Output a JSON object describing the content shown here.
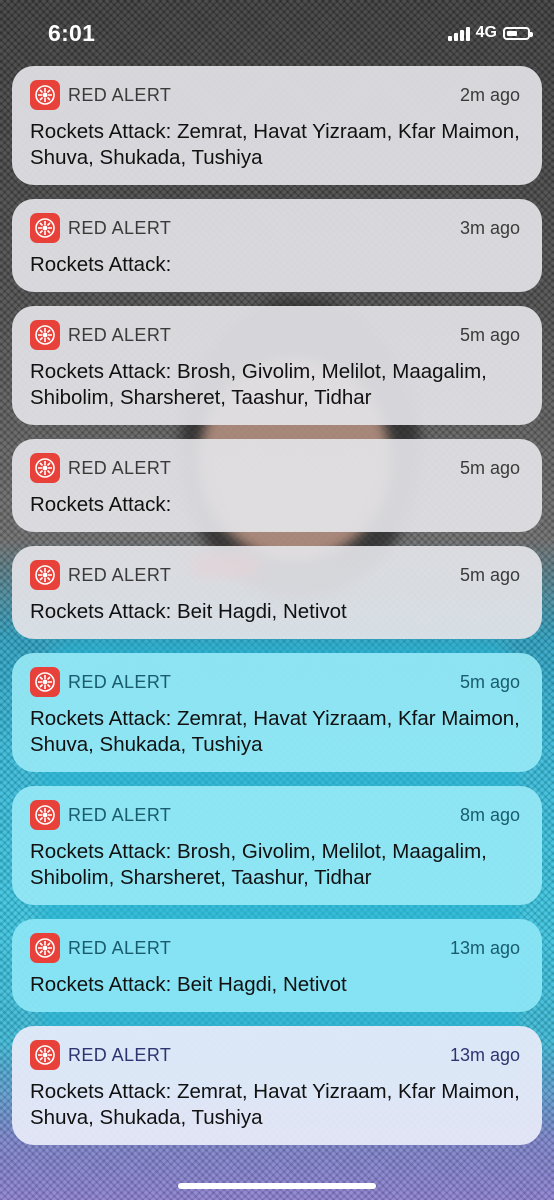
{
  "status_bar": {
    "time": "6:01",
    "network": "4G",
    "icons": [
      "signal-icon",
      "battery-icon"
    ]
  },
  "colors": {
    "app_icon": "#e8413a"
  },
  "notifications": [
    {
      "app": "RED ALERT",
      "time": "2m ago",
      "body": "Rockets Attack: Zemrat, Havat Yizraam, Kfar Maimon, Shuva, Shukada, Tushiya"
    },
    {
      "app": "RED ALERT",
      "time": "3m ago",
      "body": "Rockets Attack:"
    },
    {
      "app": "RED ALERT",
      "time": "5m ago",
      "body": "Rockets Attack: Brosh, Givolim, Melilot, Maagalim, Shibolim, Sharsheret, Taashur, Tidhar"
    },
    {
      "app": "RED ALERT",
      "time": "5m ago",
      "body": "Rockets Attack:"
    },
    {
      "app": "RED ALERT",
      "time": "5m ago",
      "body": "Rockets Attack: Beit Hagdi, Netivot"
    },
    {
      "app": "RED ALERT",
      "time": "5m ago",
      "body": "Rockets Attack: Zemrat, Havat Yizraam, Kfar Maimon, Shuva, Shukada, Tushiya"
    },
    {
      "app": "RED ALERT",
      "time": "8m ago",
      "body": "Rockets Attack: Brosh, Givolim, Melilot, Maagalim, Shibolim, Sharsheret, Taashur, Tidhar"
    },
    {
      "app": "RED ALERT",
      "time": "13m ago",
      "body": "Rockets Attack: Beit Hagdi, Netivot"
    },
    {
      "app": "RED ALERT",
      "time": "13m ago",
      "body": "Rockets Attack: Zemrat, Havat Yizraam, Kfar Maimon, Shuva, Shukada, Tushiya"
    }
  ]
}
